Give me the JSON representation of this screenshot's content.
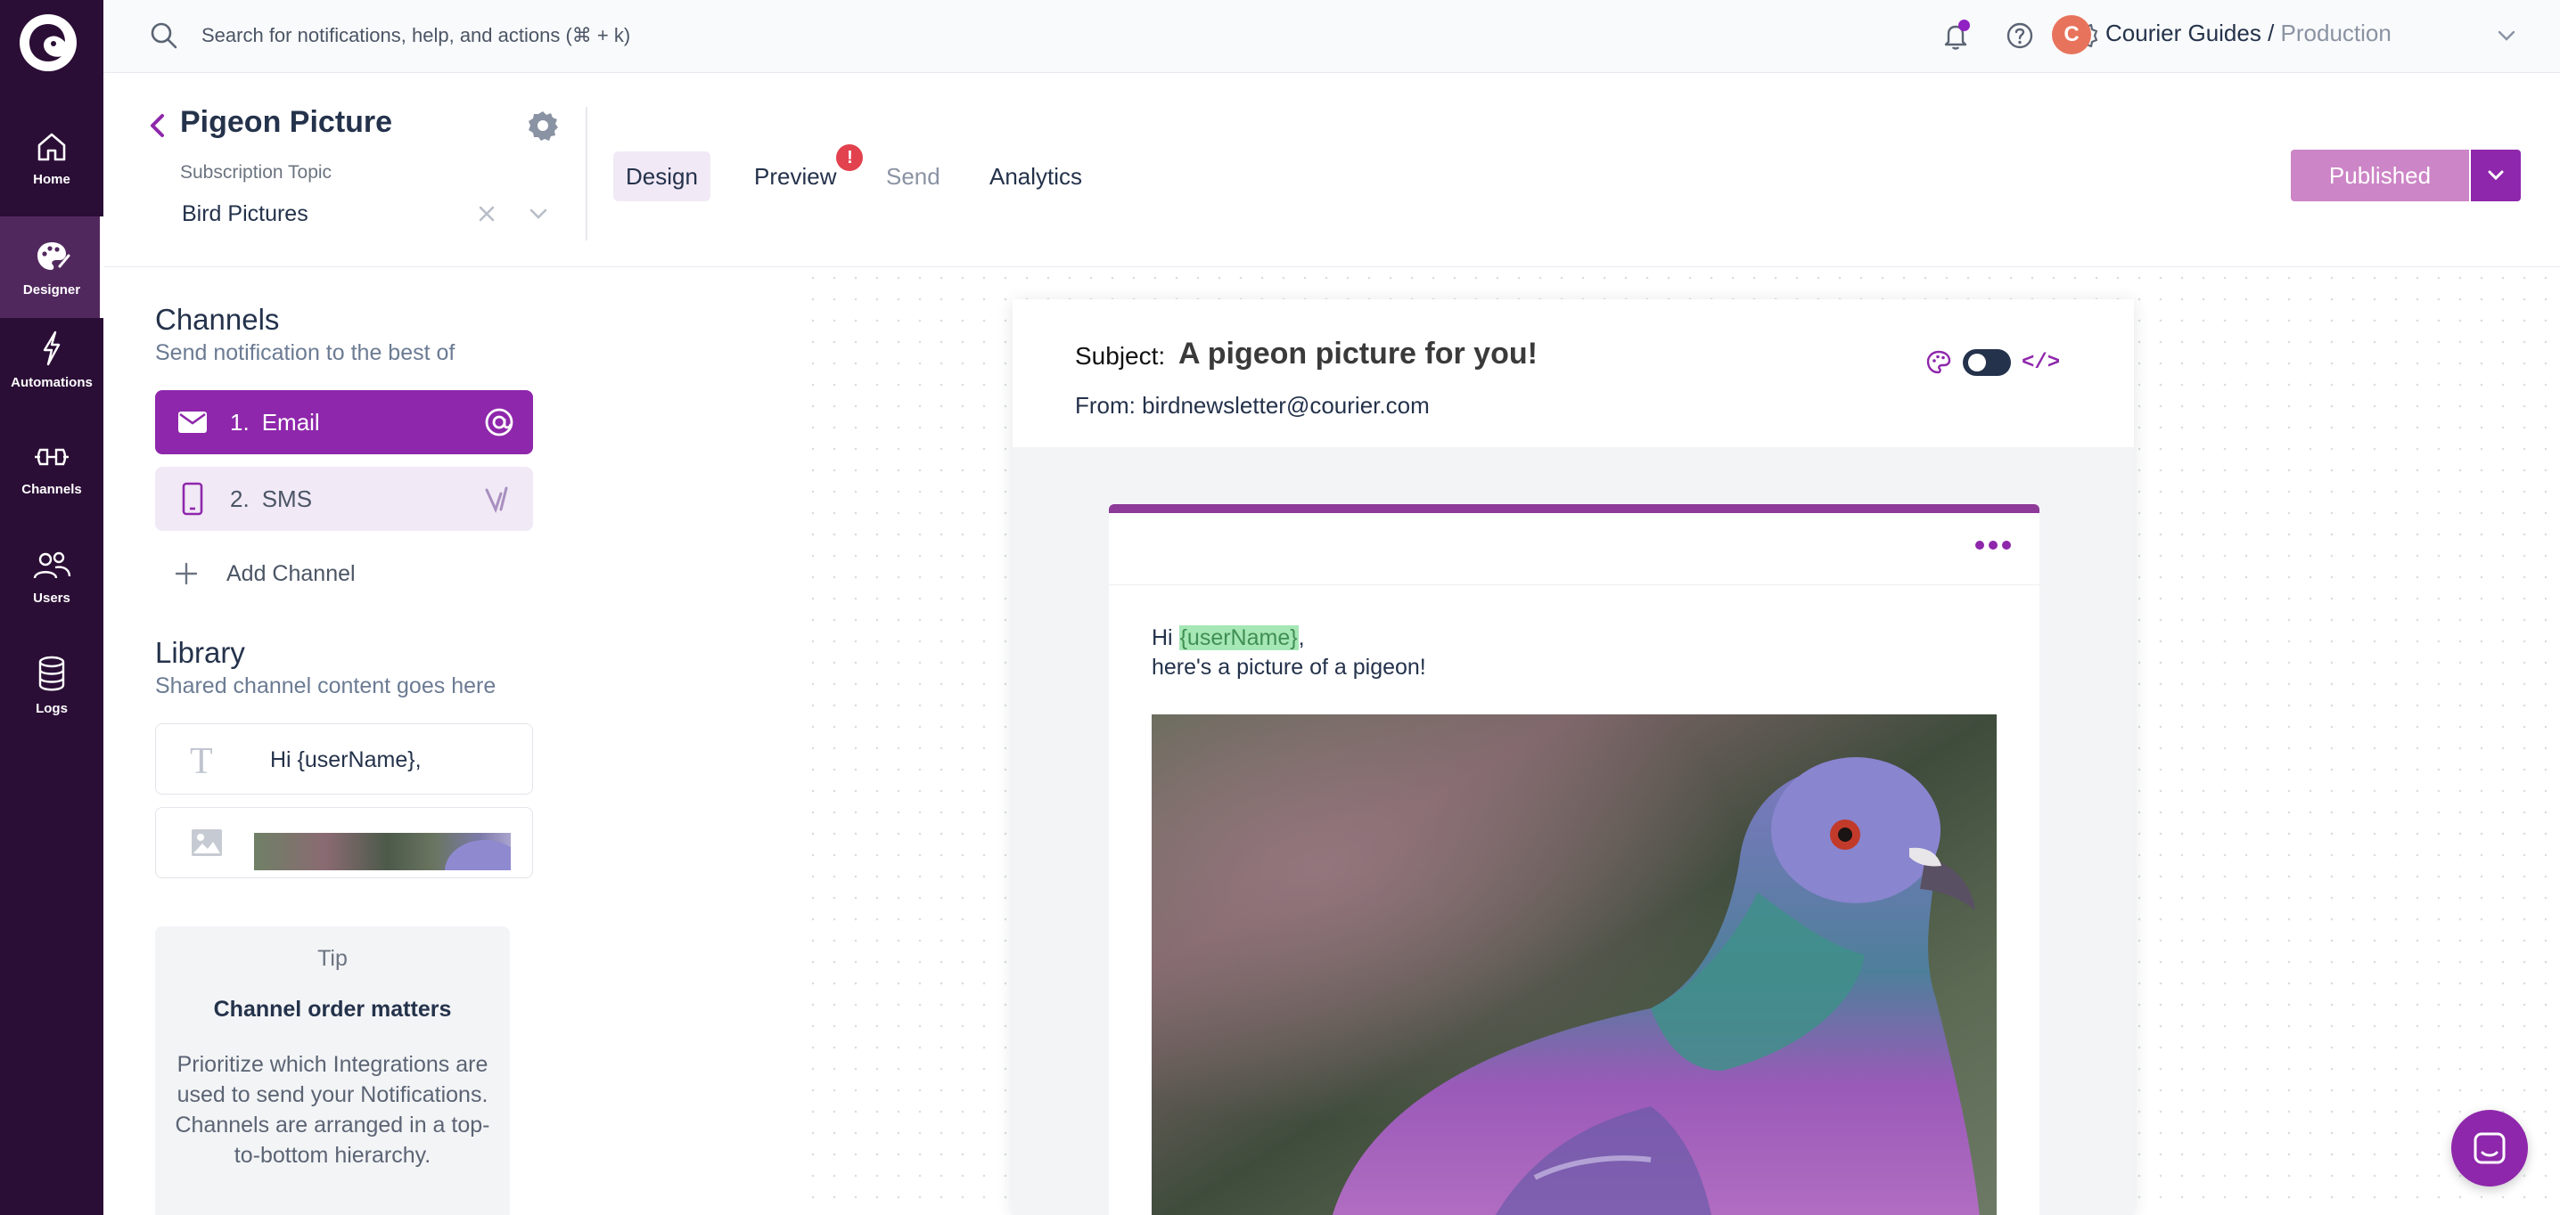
{
  "nav": {
    "logo": "courier-logo",
    "items": [
      {
        "label": "Home",
        "icon": "home-icon"
      },
      {
        "label": "Designer",
        "icon": "palette-icon",
        "active": true
      },
      {
        "label": "Automations",
        "icon": "lightning-icon"
      },
      {
        "label": "Channels",
        "icon": "channels-icon"
      },
      {
        "label": "Users",
        "icon": "users-icon"
      },
      {
        "label": "Logs",
        "icon": "database-icon"
      }
    ]
  },
  "topbar": {
    "search_placeholder": "Search for notifications, help, and actions (⌘ + k)",
    "org_initial": "C",
    "org_name": "Courier Guides /",
    "org_env": "Production"
  },
  "header": {
    "title": "Pigeon Picture",
    "subscription_label": "Subscription Topic",
    "subscription_value": "Bird Pictures",
    "tabs": [
      {
        "label": "Design",
        "active": true
      },
      {
        "label": "Preview",
        "badge": "!"
      },
      {
        "label": "Send",
        "muted": true
      },
      {
        "label": "Analytics"
      }
    ],
    "publish_label": "Published"
  },
  "sidebar": {
    "channels_title": "Channels",
    "channels_sub": "Send notification to the best of",
    "channels": [
      {
        "index": "1.",
        "label": "Email",
        "icon": "mail-icon"
      },
      {
        "index": "2.",
        "label": "SMS",
        "icon": "phone-icon"
      }
    ],
    "add_channel": "Add Channel",
    "library_title": "Library",
    "library_sub": "Shared channel content goes here",
    "library_text": "Hi {userName},",
    "tip_heading": "Tip",
    "tip_title": "Channel order matters",
    "tip_body": "Prioritize which Integrations are used to send your Notifications. Channels are arranged in a top-to-bottom hierarchy."
  },
  "email": {
    "subject_label": "Subject:",
    "subject": "A pigeon picture for you!",
    "from": "From: birdnewsletter@courier.com",
    "code_label": "</>",
    "greeting_pre": "Hi ",
    "greeting_var": "{userName}",
    "greeting_post": ",",
    "line2": "here's a picture of a pigeon!"
  },
  "colors": {
    "nav_bg": "#2b0e36",
    "accent": "#8e27ab",
    "publish_bg": "#cc85c6",
    "badge": "#e2414e"
  }
}
